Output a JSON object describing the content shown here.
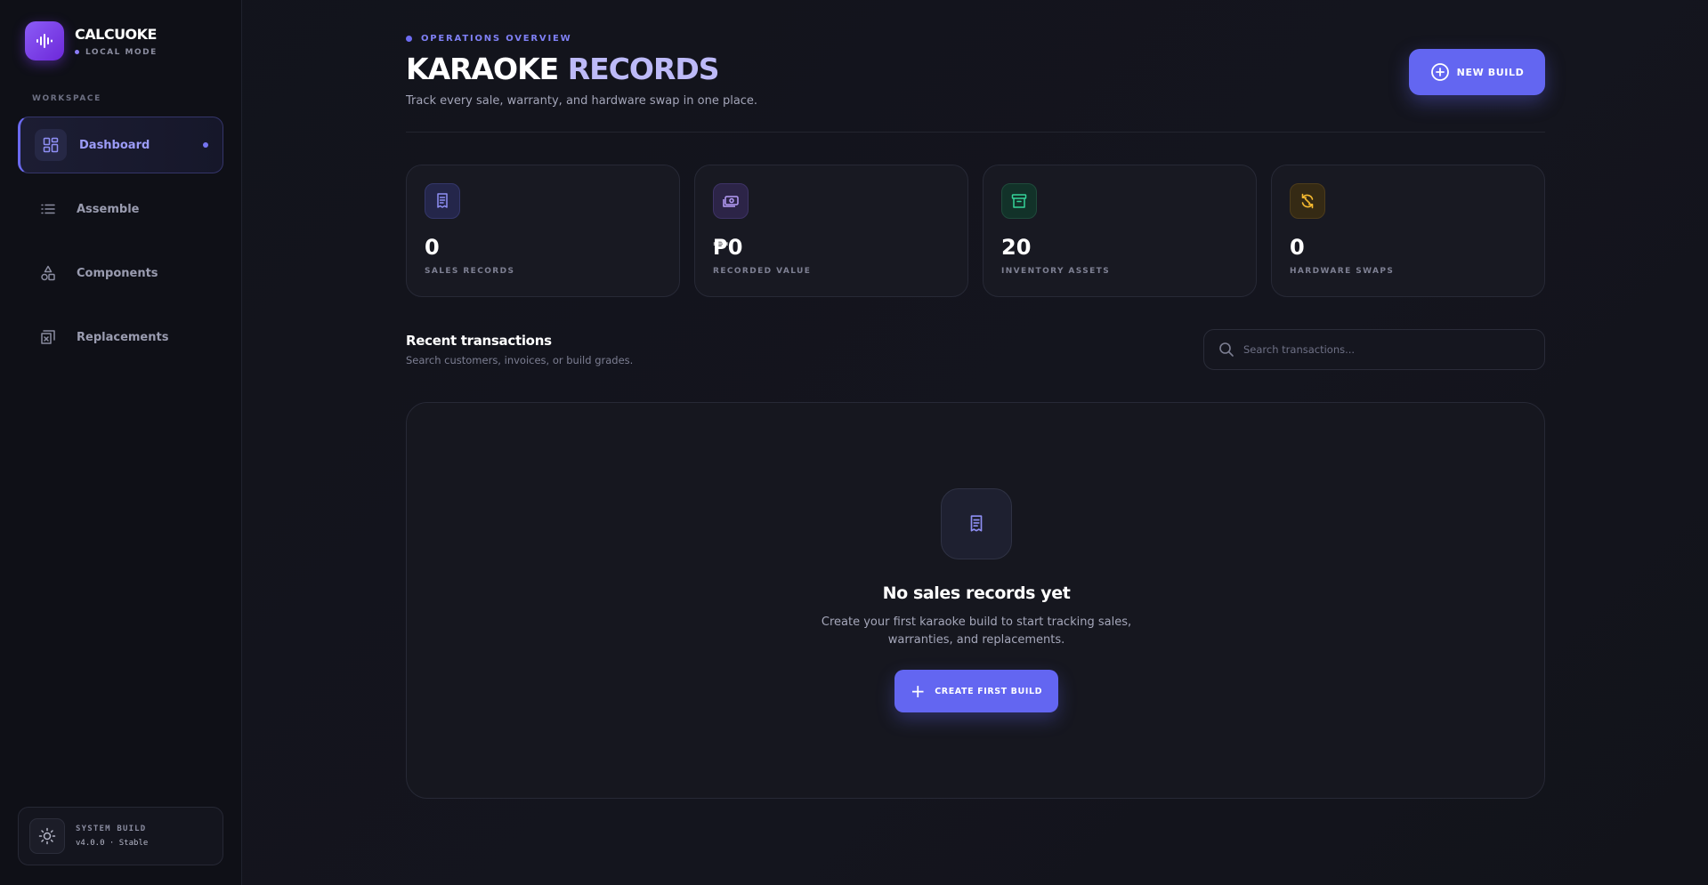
{
  "brand": {
    "name": "CALCUOKE",
    "mode": "LOCAL MODE",
    "logo_icon": "audio-waveform-icon"
  },
  "sidebar": {
    "heading": "WORKSPACE",
    "items": [
      {
        "label": "Dashboard",
        "icon": "dashboard-grid-icon",
        "active": true
      },
      {
        "label": "Assemble",
        "icon": "list-icon",
        "active": false
      },
      {
        "label": "Components",
        "icon": "shapes-icon",
        "active": false
      },
      {
        "label": "Replacements",
        "icon": "replace-icon",
        "active": false
      }
    ],
    "system": {
      "label": "SYSTEM BUILD",
      "version": "v4.0.0 · Stable",
      "icon": "sun-gear-icon"
    }
  },
  "header": {
    "eyebrow": "OPERATIONS OVERVIEW",
    "title_part1": "KARAOKE",
    "title_part2": "RECORDS",
    "subtitle": "Track every sale, warranty, and hardware swap in one place.",
    "new_build_label": "NEW BUILD"
  },
  "stats": [
    {
      "value": "0",
      "label": "SALES RECORDS",
      "icon": "receipt-icon",
      "color": "#8f8ff5"
    },
    {
      "value": "₱0",
      "label": "RECORDED VALUE",
      "icon": "banknote-icon",
      "color": "#a78bfa"
    },
    {
      "value": "20",
      "label": "INVENTORY ASSETS",
      "icon": "archive-icon",
      "color": "#34d399"
    },
    {
      "value": "0",
      "label": "HARDWARE SWAPS",
      "icon": "refresh-swap-icon",
      "color": "#f5b930"
    }
  ],
  "transactions": {
    "title": "Recent transactions",
    "subtitle": "Search customers, invoices, or build grades.",
    "search_placeholder": "Search transactions..."
  },
  "empty_state": {
    "icon": "receipt-icon",
    "title": "No sales records yet",
    "description": "Create your first karaoke build to start tracking sales, warranties, and replacements.",
    "button_label": "CREATE FIRST BUILD"
  },
  "colors": {
    "accent": "#6366f1",
    "background": "#111219"
  }
}
